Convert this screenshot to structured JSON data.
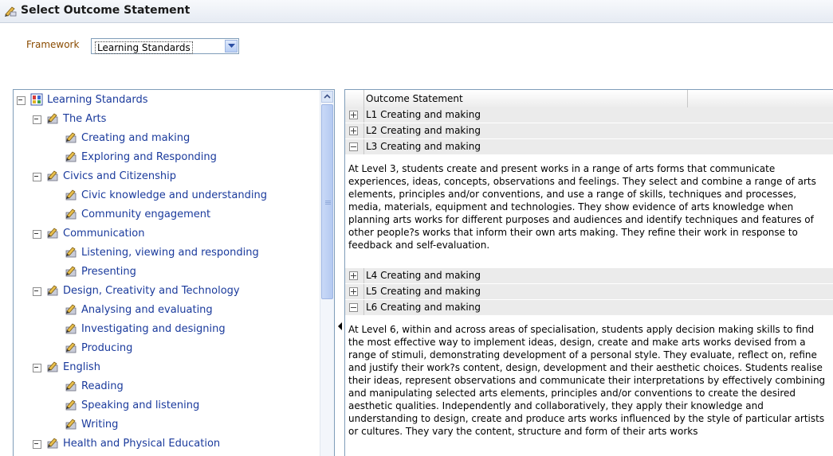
{
  "window": {
    "title": "Select Outcome Statement"
  },
  "framework": {
    "label": "Framework",
    "value": "Learning Standards"
  },
  "tree": {
    "root": "Learning Standards",
    "groups": [
      {
        "label": "The Arts",
        "children": [
          "Creating and making",
          "Exploring and Responding"
        ]
      },
      {
        "label": "Civics and Citizenship",
        "children": [
          "Civic knowledge and understanding",
          "Community engagement"
        ]
      },
      {
        "label": "Communication",
        "children": [
          "Listening, viewing and responding",
          "Presenting"
        ]
      },
      {
        "label": "Design, Creativity and Technology",
        "children": [
          "Analysing and evaluating",
          "Investigating and designing",
          "Producing"
        ]
      },
      {
        "label": "English",
        "children": [
          "Reading",
          "Speaking and listening",
          "Writing"
        ]
      },
      {
        "label": "Health and Physical Education",
        "children": []
      }
    ]
  },
  "grid": {
    "column_header": "Outcome Statement",
    "rows": [
      {
        "label": "L1 Creating and making",
        "expanded": false,
        "description": ""
      },
      {
        "label": "L2 Creating and making",
        "expanded": false,
        "description": ""
      },
      {
        "label": "L3 Creating and making",
        "expanded": true,
        "description": "At Level 3, students create and present works in a range of arts forms that communicate experiences, ideas, concepts, observations and feelings. They select and combine a range of arts elements, principles and/or conventions, and use a range of skills, techniques and processes, media, materials, equipment and technologies. They show evidence of arts knowledge when planning arts works for different purposes and audiences and identify techniques and features of other people?s works that inform their own arts making. They refine their work in response to feedback and self-evaluation."
      },
      {
        "label": "L4 Creating and making",
        "expanded": false,
        "description": ""
      },
      {
        "label": "L5 Creating and making",
        "expanded": false,
        "description": ""
      },
      {
        "label": "L6 Creating and making",
        "expanded": true,
        "description": "At Level 6, within and across areas of specialisation, students apply decision making skills to find the most effective way to implement ideas, design, create and make arts works devised from a range of stimuli, demonstrating development of a personal style. They evaluate, reflect on, refine and justify their work?s content, design, development and their aesthetic choices. Students realise their ideas, represent observations and communicate their interpretations by effectively combining and manipulating selected arts elements, principles and/or conventions to create the desired aesthetic qualities. Independently and collaboratively, they apply their knowledge and understanding to design, create and produce arts works influenced by the style of particular artists or cultures. They vary the content, structure and form of their arts works"
      }
    ]
  }
}
